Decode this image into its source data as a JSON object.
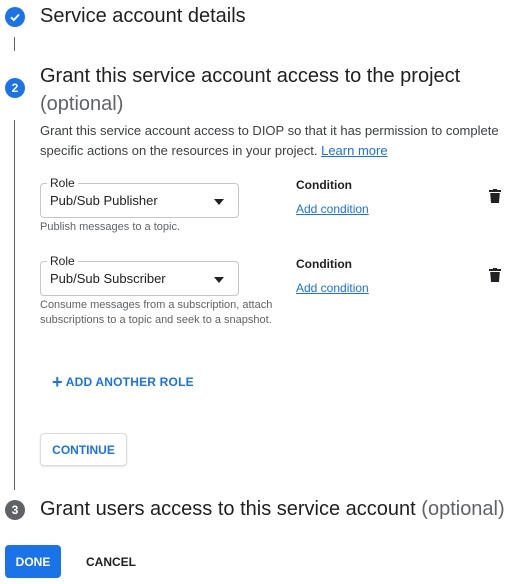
{
  "steps": {
    "step1": {
      "title": "Service account details",
      "status": "complete"
    },
    "step2": {
      "number": "2",
      "title": "Grant this service account access to the project",
      "optional": "(optional)",
      "description": "Grant this service account access to DIOP so that it has permission to complete specific actions on the resources in your project.",
      "learn_more": "Learn more",
      "roles": [
        {
          "field_label": "Role",
          "value": "Pub/Sub Publisher",
          "hint": "Publish messages to a topic.",
          "condition_title": "Condition",
          "condition_link": "Add condition"
        },
        {
          "field_label": "Role",
          "value": "Pub/Sub Subscriber",
          "hint": "Consume messages from a subscription, attach subscriptions to a topic and seek to a snapshot.",
          "condition_title": "Condition",
          "condition_link": "Add condition"
        }
      ],
      "add_role_label": "ADD ANOTHER ROLE",
      "continue_label": "CONTINUE"
    },
    "step3": {
      "number": "3",
      "title": "Grant users access to this service account",
      "optional": "(optional)"
    }
  },
  "footer": {
    "done_label": "DONE",
    "cancel_label": "CANCEL"
  },
  "colors": {
    "accent": "#1a73e8",
    "text": "#202124",
    "muted": "#5f6368"
  }
}
